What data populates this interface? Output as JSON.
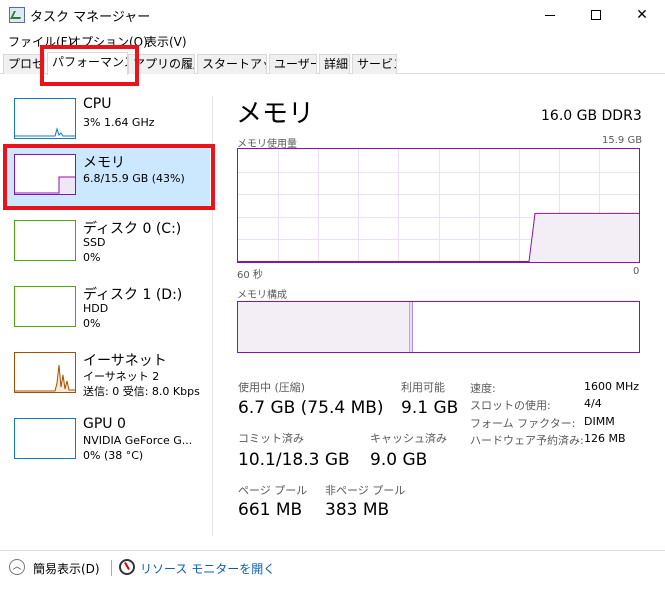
{
  "window": {
    "title": "タスク マネージャー",
    "minimize": "—",
    "close": "✕"
  },
  "menu": [
    "ファイル(F)",
    "オプション(O)",
    "表示(V)"
  ],
  "tabs": [
    {
      "label": "プロセス",
      "active": false
    },
    {
      "label": "パフォーマンス",
      "active": true
    },
    {
      "label": "アプリの履歴",
      "active": false
    },
    {
      "label": "スタートアップ",
      "active": false
    },
    {
      "label": "ユーザー",
      "active": false
    },
    {
      "label": "詳細",
      "active": false
    },
    {
      "label": "サービス",
      "active": false
    }
  ],
  "resources": [
    {
      "name": "CPU",
      "line1": "3%  1.64 GHz",
      "line2": "",
      "line3": "",
      "color": "#117dbb",
      "selected": false,
      "icon": "cpu-graph-icon"
    },
    {
      "name": "メモリ",
      "line1": "6.8/15.9 GB (43%)",
      "line2": "",
      "line3": "",
      "color": "#8b12ae",
      "selected": true,
      "icon": "memory-graph-icon"
    },
    {
      "name": "ディスク 0 (C:)",
      "line1": "SSD",
      "line2": "0%",
      "line3": "",
      "color": "#4da60c",
      "selected": false,
      "icon": "disk-graph-icon"
    },
    {
      "name": "ディスク 1 (D:)",
      "line1": "HDD",
      "line2": "0%",
      "line3": "",
      "color": "#4da60c",
      "selected": false,
      "icon": "disk-graph-icon"
    },
    {
      "name": "イーサネット",
      "line1": "イーサネット 2",
      "line2": "送信: 0 受信: 8.0 Kbps",
      "line3": "",
      "color": "#a74f01",
      "selected": false,
      "icon": "ethernet-graph-icon"
    },
    {
      "name": "GPU 0",
      "line1": "NVIDIA GeForce G...",
      "line2": "0% (38 °C)",
      "line3": "",
      "color": "#117dbb",
      "selected": false,
      "icon": "gpu-graph-icon"
    }
  ],
  "detail": {
    "title": "メモリ",
    "spec": "16.0 GB DDR3",
    "usage_label": "メモリ使用量",
    "usage_max": "15.9 GB",
    "time_left": "60 秒",
    "time_right": "0",
    "composition_label": "メモリ構成",
    "usage_fraction": 0.43,
    "composition_used_fraction": 0.43
  },
  "stats": {
    "in_use_label": "使用中 (圧縮)",
    "in_use_value": "6.7 GB (75.4 MB)",
    "available_label": "利用可能",
    "available_value": "9.1 GB",
    "committed_label": "コミット済み",
    "committed_value": "10.1/18.3 GB",
    "cached_label": "キャッシュ済み",
    "cached_value": "9.0 GB",
    "paged_label": "ページ プール",
    "paged_value": "661 MB",
    "nonpaged_label": "非ページ プール",
    "nonpaged_value": "383 MB"
  },
  "specs": [
    {
      "label": "速度:",
      "value": "1600 MHz"
    },
    {
      "label": "スロットの使用:",
      "value": "4/4"
    },
    {
      "label": "フォーム ファクター:",
      "value": "DIMM"
    },
    {
      "label": "ハードウェア予約済み:",
      "value": "126 MB"
    }
  ],
  "footer": {
    "collapse_label": "簡易表示(D)",
    "monitor_link": "リソース モニターを開く"
  }
}
